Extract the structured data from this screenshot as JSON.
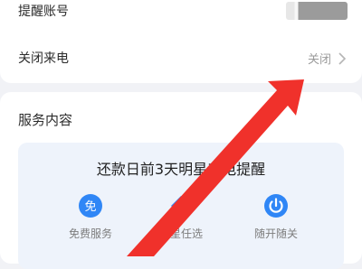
{
  "settings": {
    "remind_account_label": "提醒账号",
    "close_call_label": "关闭来电",
    "close_call_value": "关闭"
  },
  "service": {
    "section_title": "服务内容",
    "banner_text": "还款日前3天明星来电提醒",
    "features": [
      {
        "label": "免费服务",
        "icon": "free-icon",
        "icon_text": "免"
      },
      {
        "label": "明星任选",
        "icon": "star-choice-icon"
      },
      {
        "label": "随开随关",
        "icon": "power-icon"
      }
    ]
  },
  "colors": {
    "accent_blue": "#2f86f6",
    "arrow_red": "#f0312b",
    "background": "#f1f2f6"
  }
}
